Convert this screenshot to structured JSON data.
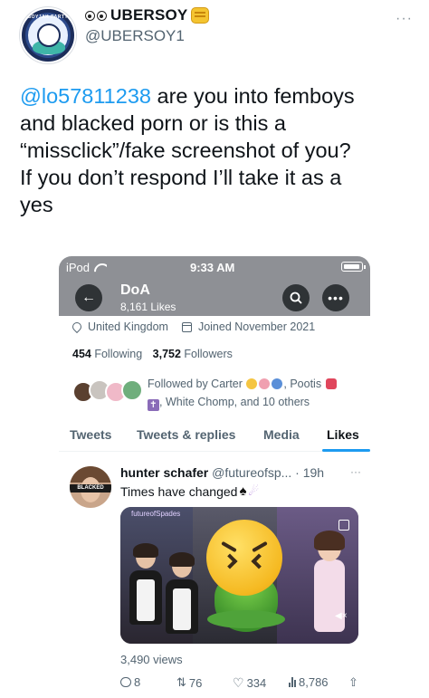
{
  "outer": {
    "display_name": "UBERSOY",
    "handle": "@UBERSOY1",
    "more": "···",
    "avatar_ring_text": "SOYJAK PARTY",
    "text_mention": "@lo57811238",
    "text_lines": [
      " are you into femboys",
      "and blacked porn or is this a",
      "“missclick”/fake screenshot of you?",
      "If you don’t respond I’ll take it as a",
      "yes"
    ]
  },
  "screenshot": {
    "status_carrier": "iPod",
    "status_time": "9:33 AM",
    "profile_name": "DoA",
    "likes_count": "8,161 Likes",
    "location": "United Kingdom",
    "joined": "Joined November 2021",
    "following_count": "454",
    "following_label": "Following",
    "followers_count": "3,752",
    "followers_label": "Followers",
    "followed_by_prefix": "Followed by Carter",
    "followed_by_mid": ", Pootis",
    "followed_by_suffix": ", White Chomp, and 10 others",
    "tabs": [
      "Tweets",
      "Tweets & replies",
      "Media",
      "Likes"
    ],
    "inner_tweet": {
      "author": "hunter schafer",
      "handle_time": "@futureofsp... · 19h",
      "more": "···",
      "text": "Times have changed",
      "avatar_band": "BLACKED",
      "watermark": "futureofSpades",
      "views": "3,490 views",
      "replies": "8",
      "retweets": "76",
      "likes": "334",
      "view_count": "8,786"
    }
  },
  "colors": {
    "link_blue": "#1d9bf0",
    "header_gray": "#8e9095",
    "muted_text": "#536471"
  }
}
